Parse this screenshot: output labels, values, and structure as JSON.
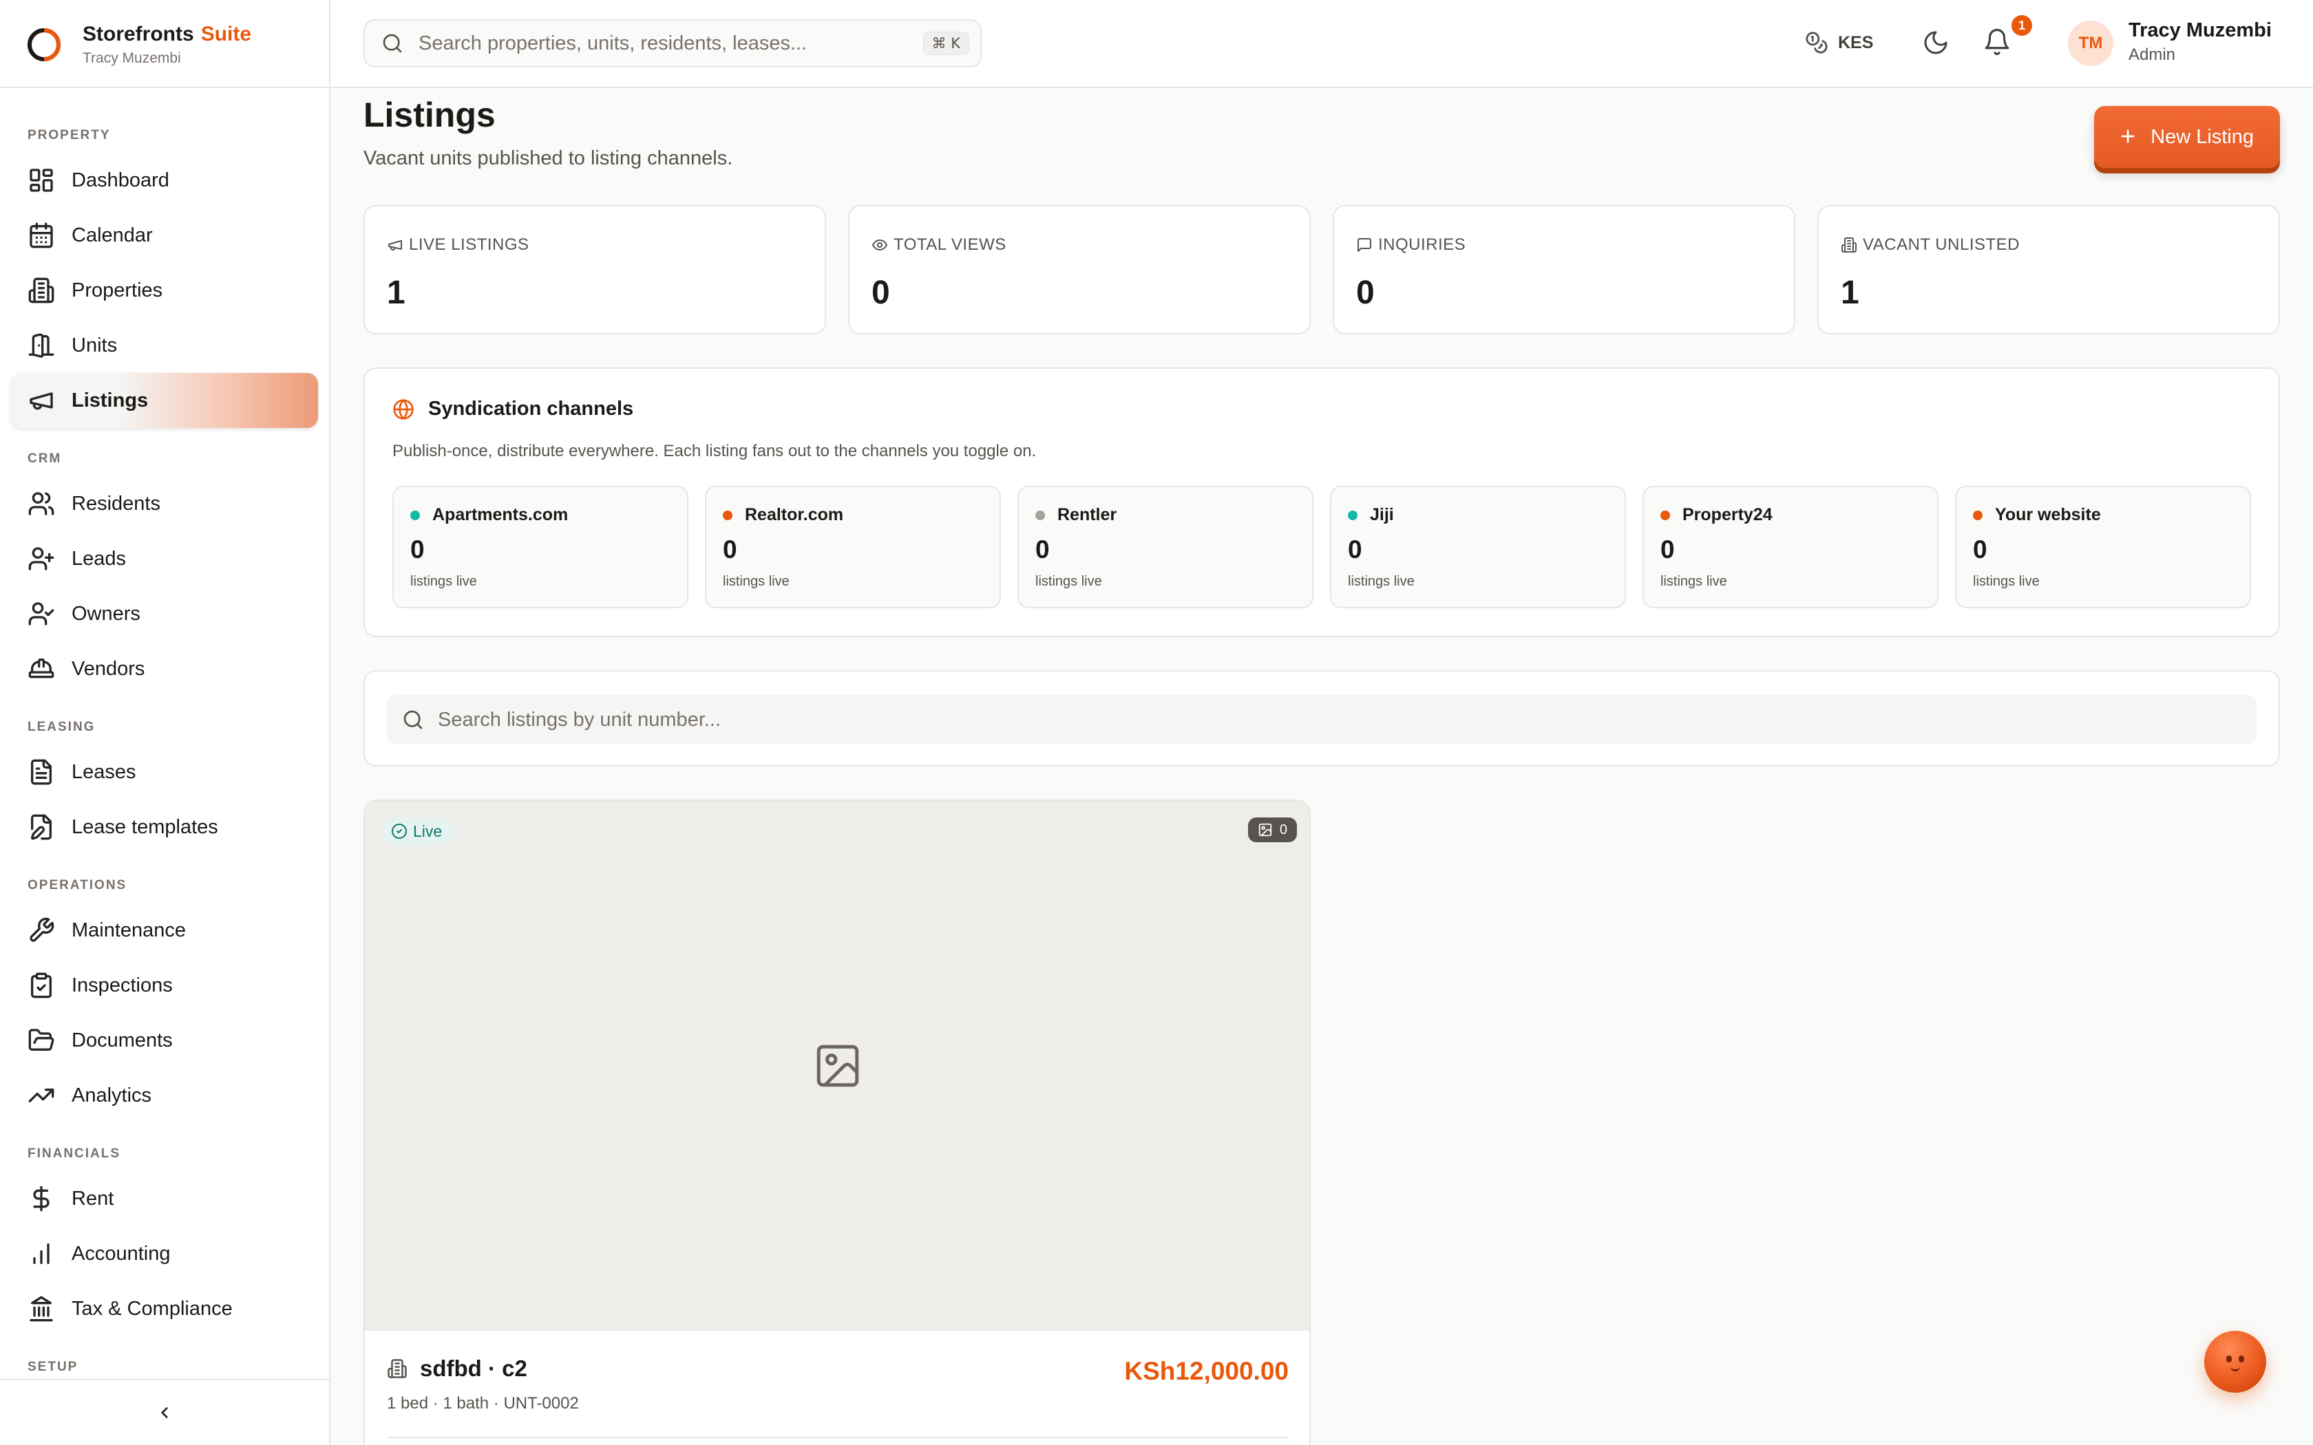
{
  "app": {
    "name": "Storefronts",
    "suite_label": "Suite",
    "workspace_user": "Tracy Muzembi"
  },
  "sidebar": {
    "sections": [
      {
        "label": "PROPERTY",
        "items": [
          {
            "label": "Dashboard",
            "icon": "dashboard-icon"
          },
          {
            "label": "Calendar",
            "icon": "calendar-icon"
          },
          {
            "label": "Properties",
            "icon": "building-icon"
          },
          {
            "label": "Units",
            "icon": "door-icon"
          },
          {
            "label": "Listings",
            "icon": "megaphone-icon",
            "active": true
          }
        ]
      },
      {
        "label": "CRM",
        "items": [
          {
            "label": "Residents",
            "icon": "users-icon"
          },
          {
            "label": "Leads",
            "icon": "user-plus-icon"
          },
          {
            "label": "Owners",
            "icon": "user-check-icon"
          },
          {
            "label": "Vendors",
            "icon": "hard-hat-icon"
          }
        ]
      },
      {
        "label": "LEASING",
        "items": [
          {
            "label": "Leases",
            "icon": "file-text-icon"
          },
          {
            "label": "Lease templates",
            "icon": "file-edit-icon"
          }
        ]
      },
      {
        "label": "OPERATIONS",
        "items": [
          {
            "label": "Maintenance",
            "icon": "wrench-icon"
          },
          {
            "label": "Inspections",
            "icon": "clipboard-check-icon"
          },
          {
            "label": "Documents",
            "icon": "folder-open-icon"
          },
          {
            "label": "Analytics",
            "icon": "trending-up-icon"
          }
        ]
      },
      {
        "label": "FINANCIALS",
        "items": [
          {
            "label": "Rent",
            "icon": "dollar-icon"
          },
          {
            "label": "Accounting",
            "icon": "bar-chart-icon"
          },
          {
            "label": "Tax & Compliance",
            "icon": "landmark-icon"
          }
        ]
      },
      {
        "label": "SETUP",
        "items": []
      }
    ],
    "collapse_icon": "chevron-left-icon"
  },
  "topbar": {
    "search_placeholder": "Search properties, units, residents, leases...",
    "shortcut": "⌘ K",
    "currency": "KES",
    "notification_count": "1",
    "user_initials": "TM",
    "user_name": "Tracy Muzembi",
    "user_role": "Admin"
  },
  "page": {
    "title": "Listings",
    "subtitle": "Vacant units published to listing channels.",
    "new_button": "New Listing"
  },
  "stats": [
    {
      "label": "LIVE LISTINGS",
      "value": "1",
      "icon": "megaphone-icon"
    },
    {
      "label": "TOTAL VIEWS",
      "value": "0",
      "icon": "eye-icon"
    },
    {
      "label": "INQUIRIES",
      "value": "0",
      "icon": "message-square-icon"
    },
    {
      "label": "VACANT UNLISTED",
      "value": "1",
      "icon": "building-icon"
    }
  ],
  "syndication": {
    "title": "Syndication channels",
    "description": "Publish-once, distribute everywhere. Each listing fans out to the channels you toggle on.",
    "channels": [
      {
        "name": "Apartments.com",
        "count": "0",
        "unit": "listings live",
        "color": "#14b8a6"
      },
      {
        "name": "Realtor.com",
        "count": "0",
        "unit": "listings live",
        "color": "#ea580c"
      },
      {
        "name": "Rentler",
        "count": "0",
        "unit": "listings live",
        "color": "#a8a29e"
      },
      {
        "name": "Jiji",
        "count": "0",
        "unit": "listings live",
        "color": "#14b8a6"
      },
      {
        "name": "Property24",
        "count": "0",
        "unit": "listings live",
        "color": "#ea580c"
      },
      {
        "name": "Your website",
        "count": "0",
        "unit": "listings live",
        "color": "#ea580c"
      }
    ]
  },
  "filter": {
    "placeholder": "Search listings by unit number..."
  },
  "listings": [
    {
      "status": "Live",
      "photo_count": "0",
      "title": "sdfbd · c2",
      "meta": "1 bed · 1 bath · UNT-0002",
      "price": "KSh12,000.00"
    }
  ],
  "colors": {
    "accent": "#ea580c",
    "success": "#0f766e"
  }
}
